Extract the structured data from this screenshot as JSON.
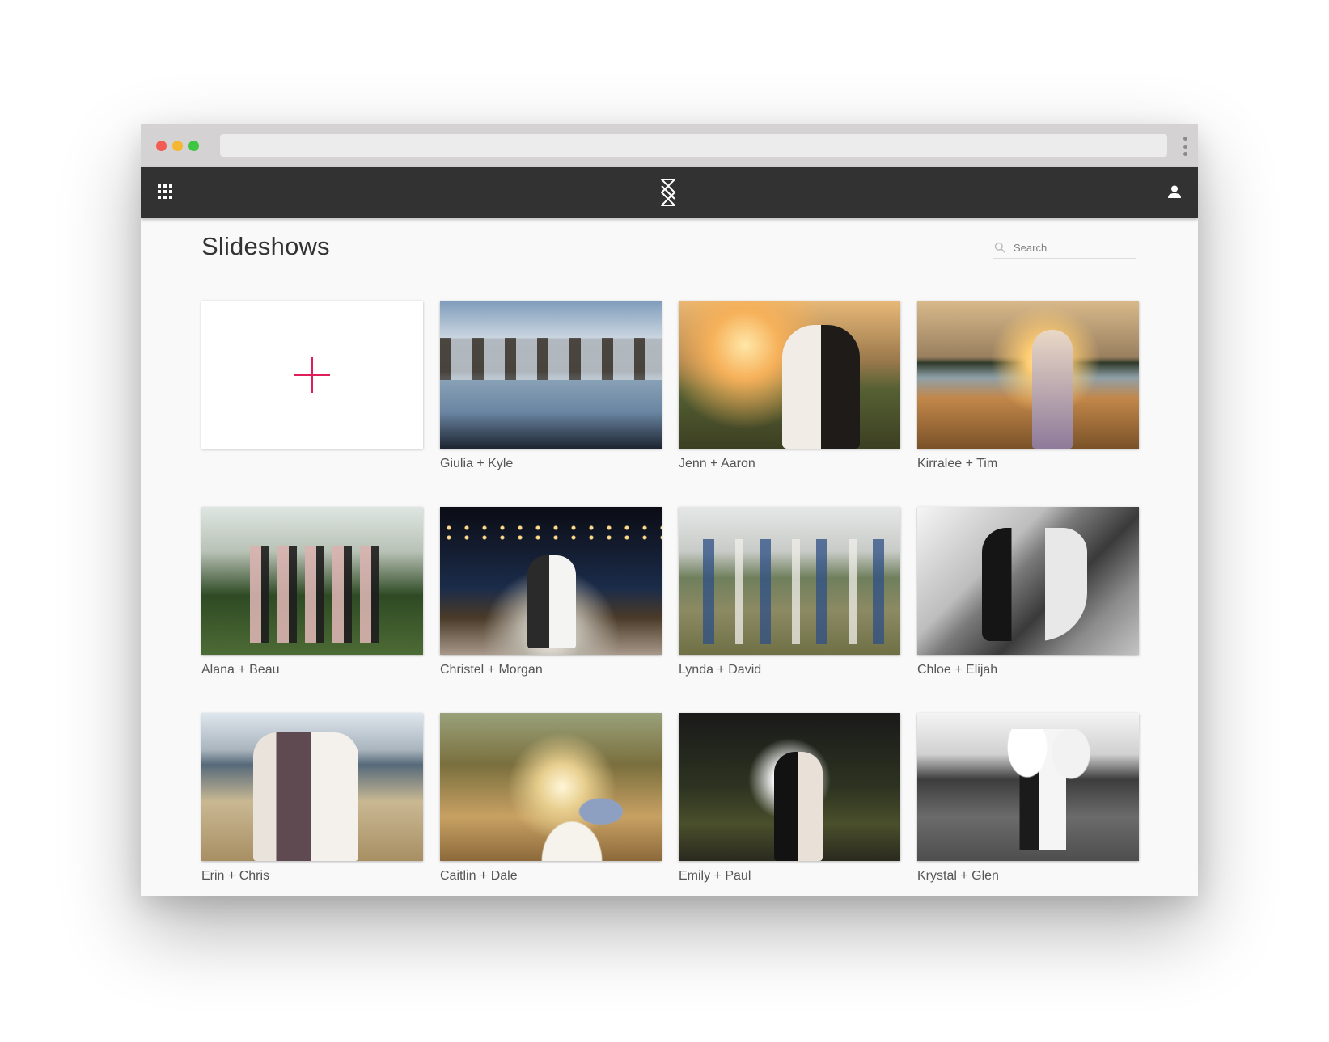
{
  "browser": {
    "window_controls": [
      "close",
      "minimize",
      "maximize"
    ],
    "address": ""
  },
  "header": {
    "apps_icon": "grid-apps-icon",
    "logo_icon": "hourglass-logo-icon",
    "user_icon": "user-icon",
    "background": "#323232"
  },
  "page": {
    "title": "Slideshows"
  },
  "search": {
    "placeholder": "Search",
    "value": ""
  },
  "new_card": {
    "icon": "plus-icon",
    "accent": "#e01e5a"
  },
  "slideshows": [
    {
      "caption": "Giulia + Kyle"
    },
    {
      "caption": "Jenn + Aaron"
    },
    {
      "caption": "Kirralee + Tim"
    },
    {
      "caption": "Alana + Beau"
    },
    {
      "caption": "Christel + Morgan"
    },
    {
      "caption": "Lynda + David"
    },
    {
      "caption": "Chloe + Elijah"
    },
    {
      "caption": "Erin + Chris"
    },
    {
      "caption": "Caitlin + Dale"
    },
    {
      "caption": "Emily + Paul"
    },
    {
      "caption": "Krystal + Glen"
    }
  ]
}
